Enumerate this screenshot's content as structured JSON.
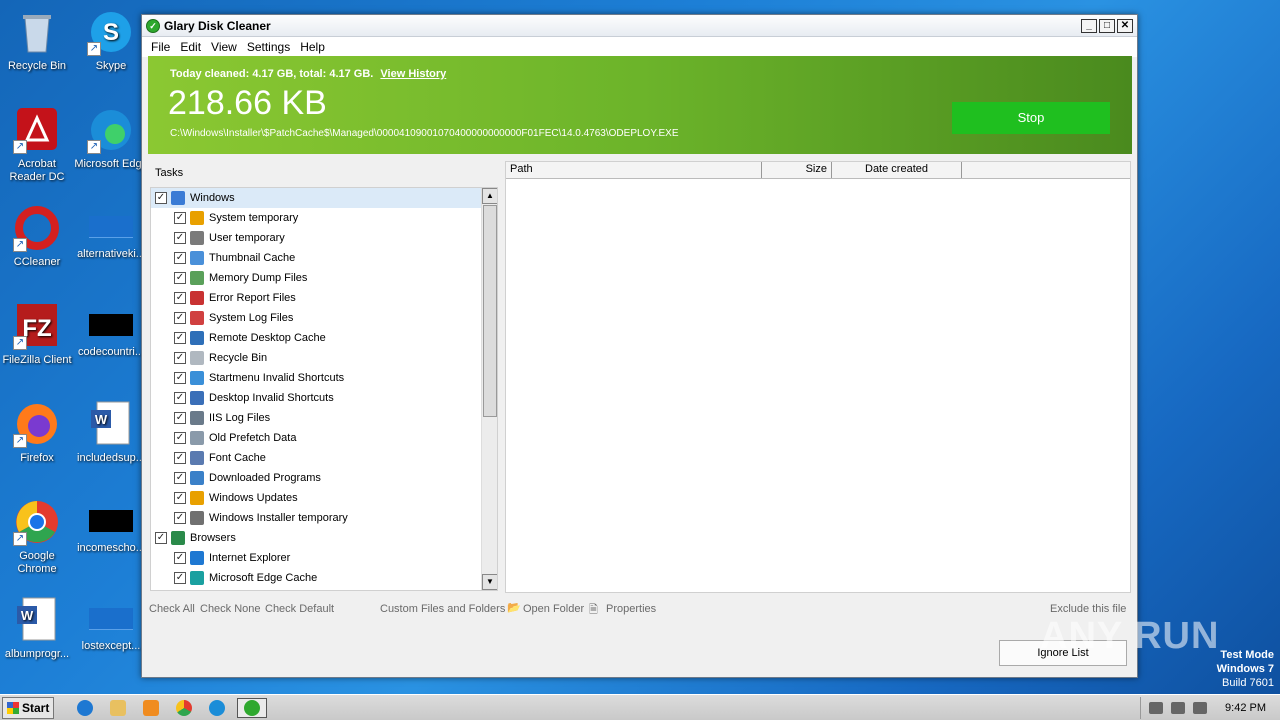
{
  "desktop": {
    "icons": [
      {
        "label": "Recycle Bin",
        "icon": "recycle-bin-icon"
      },
      {
        "label": "Skype",
        "icon": "skype-icon"
      },
      {
        "label": "Acrobat Reader DC",
        "icon": "acrobat-icon"
      },
      {
        "label": "Microsoft Edge",
        "icon": "edge-icon"
      },
      {
        "label": "CCleaner",
        "icon": "ccleaner-icon"
      },
      {
        "label": "alternativeki...",
        "icon": "file-icon"
      },
      {
        "label": "FileZilla Client",
        "icon": "filezilla-icon"
      },
      {
        "label": "codecountri...",
        "icon": "file-icon"
      },
      {
        "label": "Firefox",
        "icon": "firefox-icon"
      },
      {
        "label": "includedsup...",
        "icon": "word-doc-icon"
      },
      {
        "label": "Google Chrome",
        "icon": "chrome-icon"
      },
      {
        "label": "incomescho...",
        "icon": "file-icon"
      },
      {
        "label": "albumprogr...",
        "icon": "word-doc-icon"
      },
      {
        "label": "lostexcept...",
        "icon": "file-icon"
      }
    ]
  },
  "window": {
    "title": "Glary Disk Cleaner",
    "controls": {
      "minimize": "_",
      "maximize": "□",
      "close": "✕"
    },
    "menu": [
      "File",
      "Edit",
      "View",
      "Settings",
      "Help"
    ]
  },
  "banner": {
    "today_text": "Today cleaned: 4.17 GB, total: 4.17 GB.",
    "view_history": "View History",
    "size": "218.66 KB",
    "current_path": "C:\\Windows\\Installer\\$PatchCache$\\Managed\\00004109001070400000000000F01FEC\\14.0.4763\\ODEPLOY.EXE",
    "stop_label": "Stop"
  },
  "tasks": {
    "label": "Tasks",
    "items": [
      {
        "label": "Windows",
        "level": 0,
        "checked": true,
        "color": "#3a7bd5"
      },
      {
        "label": "System temporary",
        "level": 1,
        "checked": true,
        "color": "#e8a000"
      },
      {
        "label": "User temporary",
        "level": 1,
        "checked": true,
        "color": "#7a7a7a"
      },
      {
        "label": "Thumbnail Cache",
        "level": 1,
        "checked": true,
        "color": "#4a90d9"
      },
      {
        "label": "Memory Dump Files",
        "level": 1,
        "checked": true,
        "color": "#5aa05a"
      },
      {
        "label": "Error Report Files",
        "level": 1,
        "checked": true,
        "color": "#c83232"
      },
      {
        "label": "System Log Files",
        "level": 1,
        "checked": true,
        "color": "#d04040"
      },
      {
        "label": "Remote Desktop Cache",
        "level": 1,
        "checked": true,
        "color": "#2e6fb8"
      },
      {
        "label": "Recycle Bin",
        "level": 1,
        "checked": true,
        "color": "#b0b8c0"
      },
      {
        "label": "Startmenu Invalid Shortcuts",
        "level": 1,
        "checked": true,
        "color": "#3a8fd8"
      },
      {
        "label": "Desktop Invalid Shortcuts",
        "level": 1,
        "checked": true,
        "color": "#3a6fb8"
      },
      {
        "label": "IIS Log Files",
        "level": 1,
        "checked": true,
        "color": "#6a7a8a"
      },
      {
        "label": "Old Prefetch Data",
        "level": 1,
        "checked": true,
        "color": "#8a9aaa"
      },
      {
        "label": "Font Cache",
        "level": 1,
        "checked": true,
        "color": "#5a7ab0"
      },
      {
        "label": "Downloaded Programs",
        "level": 1,
        "checked": true,
        "color": "#3a80c8"
      },
      {
        "label": "Windows Updates",
        "level": 1,
        "checked": true,
        "color": "#e8a000"
      },
      {
        "label": "Windows Installer temporary",
        "level": 1,
        "checked": true,
        "color": "#707070"
      },
      {
        "label": "Browsers",
        "level": 0,
        "checked": true,
        "color": "#2a8a4a"
      },
      {
        "label": "Internet Explorer",
        "level": 1,
        "checked": true,
        "color": "#1e78d2"
      },
      {
        "label": "Microsoft Edge Cache",
        "level": 1,
        "checked": true,
        "color": "#1aa0a0"
      }
    ]
  },
  "results": {
    "columns": [
      "Path",
      "Size",
      "Date created"
    ]
  },
  "actions": {
    "check_all": "Check All",
    "check_none": "Check None",
    "check_default": "Check Default",
    "custom": "Custom Files and Folders",
    "open_folder": "Open Folder",
    "properties": "Properties",
    "exclude": "Exclude this file",
    "ignore_list": "Ignore List"
  },
  "watermark": "ANY RUN",
  "sysinfo": {
    "line1": "Test Mode",
    "line2": "Windows 7",
    "line3": "Build 7601"
  },
  "taskbar": {
    "start_label": "Start",
    "apps": [
      "ie-icon",
      "explorer-icon",
      "media-player-icon",
      "chrome-icon",
      "edge-icon",
      "glary-icon"
    ],
    "clock": "9:42 PM"
  }
}
